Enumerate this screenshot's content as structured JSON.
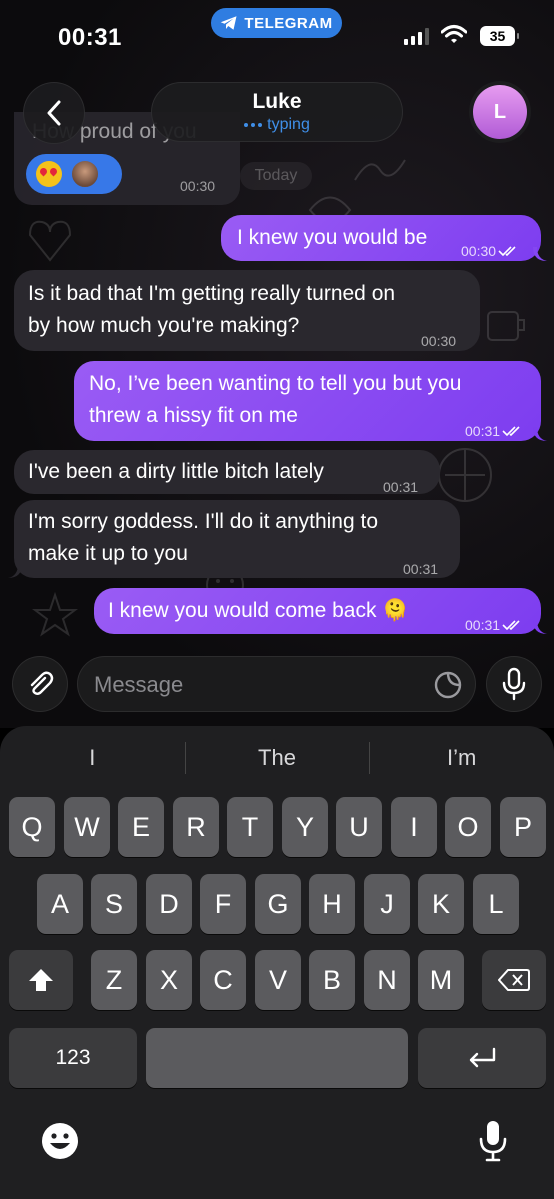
{
  "status_bar": {
    "time": "00:31",
    "app_pill": "TELEGRAM",
    "battery": "35"
  },
  "header": {
    "name": "Luke",
    "status": "typing",
    "avatar_initial": "L",
    "avatar_gradient": [
      "#e79cf0",
      "#b15bd6"
    ]
  },
  "partial_message": {
    "text": "How proud of you",
    "time": "00:30",
    "reactions": [
      "heart-eyes-emoji",
      "avatar"
    ]
  },
  "date_chip": "Today",
  "messages": [
    {
      "dir": "out",
      "text": "I knew you would be",
      "time": "00:30",
      "read": true
    },
    {
      "dir": "in",
      "text": "Is it bad that I'm getting really turned on\nby how much you're making?",
      "time": "00:30"
    },
    {
      "dir": "out",
      "text": "No, I’ve been wanting to tell you but you\nthrew a hissy fit on me",
      "time": "00:31",
      "read": true
    },
    {
      "dir": "in",
      "text": "I've been a dirty little bitch lately",
      "time": "00:31"
    },
    {
      "dir": "in",
      "text": "I'm sorry goddess. I'll do it anything to\nmake it up to you",
      "time": "00:31"
    },
    {
      "dir": "out",
      "text": "I knew you would come back 🫠",
      "time": "00:31",
      "read": true
    }
  ],
  "input": {
    "placeholder": "Message"
  },
  "keyboard": {
    "suggestions": [
      "I",
      "The",
      "I’m"
    ],
    "row1": [
      "Q",
      "W",
      "E",
      "R",
      "T",
      "Y",
      "U",
      "I",
      "O",
      "P"
    ],
    "row2": [
      "A",
      "S",
      "D",
      "F",
      "G",
      "H",
      "J",
      "K",
      "L"
    ],
    "row3": [
      "Z",
      "X",
      "C",
      "V",
      "B",
      "N",
      "M"
    ],
    "numbers_key": "123"
  },
  "colors": {
    "outgoing_bubble": "#8a4cf2",
    "incoming_bubble": "#2a282e",
    "accent_blue": "#3f8fe8",
    "telegram_pill": "#2f7de1"
  }
}
